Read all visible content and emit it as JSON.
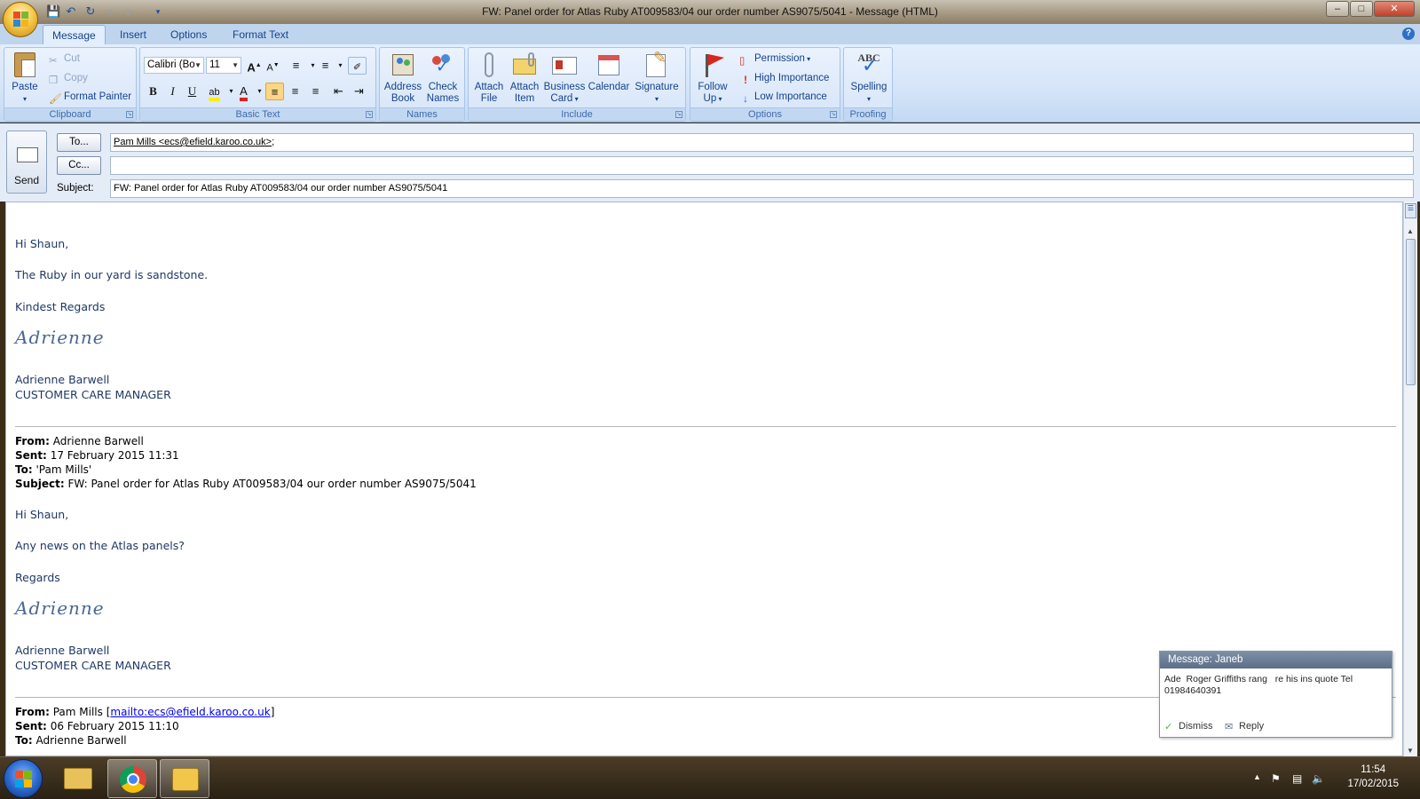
{
  "window": {
    "title": "FW: Panel order for Atlas Ruby AT009583/04 our order number AS9075/5041 - Message (HTML)"
  },
  "ribbon": {
    "tabs": [
      "Message",
      "Insert",
      "Options",
      "Format Text"
    ],
    "active_tab": "Message",
    "clipboard": {
      "label": "Clipboard",
      "paste": "Paste",
      "cut": "Cut",
      "copy": "Copy",
      "format_painter": "Format Painter"
    },
    "basic_text": {
      "label": "Basic Text",
      "font": "Calibri (Bo",
      "size": "11"
    },
    "names": {
      "label": "Names",
      "address_book_1": "Address",
      "address_book_2": "Book",
      "check_names_1": "Check",
      "check_names_2": "Names"
    },
    "include": {
      "label": "Include",
      "attach_file_1": "Attach",
      "attach_file_2": "File",
      "attach_item_1": "Attach",
      "attach_item_2": "Item",
      "business_card_1": "Business",
      "business_card_2": "Card",
      "calendar": "Calendar",
      "signature": "Signature"
    },
    "options": {
      "label": "Options",
      "follow_up_1": "Follow",
      "follow_up_2": "Up",
      "permission": "Permission",
      "high_importance": "High Importance",
      "low_importance": "Low Importance"
    },
    "proofing": {
      "label": "Proofing",
      "abc": "ABC",
      "spelling": "Spelling"
    }
  },
  "compose": {
    "send": "Send",
    "to_button": "To...",
    "cc_button": "Cc...",
    "subject_label": "Subject:",
    "to_value": "Pam Mills <ecs@efield.karoo.co.uk>",
    "to_suffix": ";",
    "cc_value": "",
    "subject_value": "FW: Panel order for Atlas Ruby AT009583/04 our order number AS9075/5041"
  },
  "body": {
    "m1_greeting": "Hi Shaun,",
    "m1_line": "The Ruby in our yard is sandstone.",
    "m1_closing": "Kindest Regards",
    "m1_sig_script": "Adrienne",
    "m1_name": "Adrienne Barwell",
    "m1_role": "CUSTOMER CARE MANAGER",
    "h2_from_label": "From:",
    "h2_from": "Adrienne Barwell",
    "h2_sent_label": "Sent:",
    "h2_sent": "17 February 2015 11:31",
    "h2_to_label": "To:",
    "h2_to": "'Pam Mills'",
    "h2_subject_label": "Subject:",
    "h2_subject": "FW: Panel order for Atlas Ruby AT009583/04 our order number AS9075/5041",
    "m2_greeting": "Hi Shaun,",
    "m2_line": "Any news on the Atlas panels?",
    "m2_closing": "Regards",
    "m2_sig_script": "Adrienne",
    "m2_name": "Adrienne Barwell",
    "m2_role": "CUSTOMER CARE MANAGER",
    "h3_from_label": "From:",
    "h3_from": "Pam Mills [",
    "h3_from_link": "mailto:ecs@efield.karoo.co.uk",
    "h3_from_end": "]",
    "h3_sent_label": "Sent:",
    "h3_sent": "06 February 2015 11:10",
    "h3_to_label": "To:",
    "h3_to": "Adrienne Barwell"
  },
  "notification": {
    "title": "Message: Janeb",
    "text": "Ade  Roger Griffiths rang   re his ins quote Tel 01984640391",
    "dismiss": "Dismiss",
    "reply": "Reply"
  },
  "taskbar": {
    "time": "11:54",
    "date": "17/02/2015"
  },
  "colors": {
    "ribbon_text": "#15428b",
    "body_text": "#1f3864",
    "link": "#0000ee"
  }
}
